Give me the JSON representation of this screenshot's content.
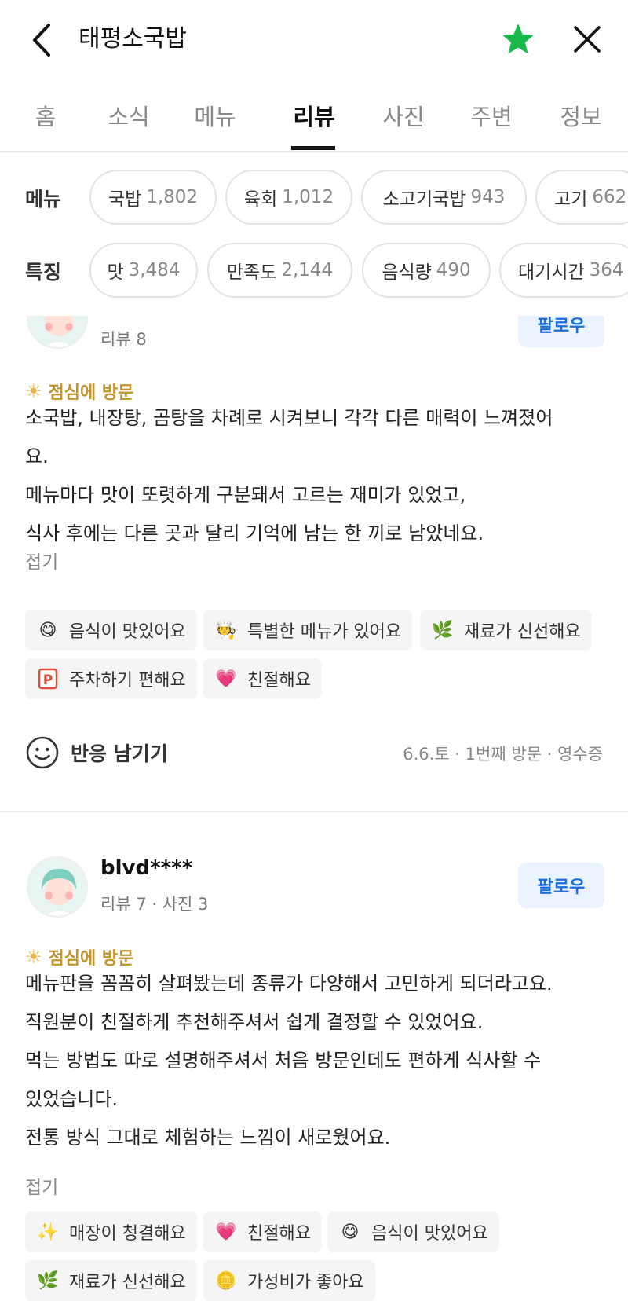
{
  "header": {
    "title": "태평소국밥",
    "back_icon": "chevron-left-icon",
    "star_icon": "star-icon",
    "close_icon": "close-icon",
    "star_color": "#18b849"
  },
  "tabs": [
    {
      "label": "홈"
    },
    {
      "label": "소식"
    },
    {
      "label": "메뉴"
    },
    {
      "label": "리뷰",
      "active": true
    },
    {
      "label": "사진"
    },
    {
      "label": "주변"
    },
    {
      "label": "정보"
    }
  ],
  "filters": {
    "menu": {
      "label": "메뉴",
      "chips": [
        {
          "name": "국밥",
          "count": "1,802"
        },
        {
          "name": "육회",
          "count": "1,012"
        },
        {
          "name": "소고기국밥",
          "count": "943"
        },
        {
          "name": "고기",
          "count": "662"
        }
      ]
    },
    "feature": {
      "label": "특징",
      "chips": [
        {
          "name": "맛",
          "count": "3,484"
        },
        {
          "name": "만족도",
          "count": "2,144"
        },
        {
          "name": "음식량",
          "count": "490"
        },
        {
          "name": "대기시간",
          "count": "364"
        }
      ]
    }
  },
  "review1": {
    "follow": "팔로우",
    "meta": "리뷰 8",
    "visit": "점심에 방문",
    "lines": [
      "소국밥, 내장탕, 곰탕을 차례로 시켜보니 각각 다른 매력이 느껴졌어",
      "요.",
      "메뉴마다 맛이 또렷하게 구분돼서 고르는 재미가 있었고,",
      "식사 후에는 다른 곳과 달리 기억에 남는 한 끼로 남았네요."
    ],
    "fold": "접기",
    "tags": [
      {
        "icon": "smile-emoji-icon",
        "label": "음식이 맛있어요"
      },
      {
        "icon": "chef-icon",
        "label": "특별한 메뉴가 있어요"
      },
      {
        "icon": "leaf-icon",
        "label": "재료가 신선해요"
      },
      {
        "icon": "parking-icon",
        "label": "주차하기 편해요"
      },
      {
        "icon": "heart-icon",
        "label": "친절해요"
      }
    ],
    "react_label": "반응 남기기",
    "visit_info": "6.6.토 · 1번째 방문 · 영수증"
  },
  "review2": {
    "nickname": "blvd****",
    "follow": "팔로우",
    "meta": "리뷰 7 · 사진 3",
    "visit": "점심에 방문",
    "lines": [
      "메뉴판을 꼼꼼히 살펴봤는데 종류가 다양해서 고민하게 되더라고요.",
      "직원분이 친절하게 추천해주셔서 쉽게 결정할 수 있었어요.",
      "먹는 방법도 따로 설명해주셔서 처음 방문인데도 편하게 식사할 수",
      "있었습니다.",
      "전통 방식 그대로 체험하는 느낌이 새로웠어요."
    ],
    "fold": "접기",
    "tags": [
      {
        "icon": "sparkle-icon",
        "label": "매장이 청결해요"
      },
      {
        "icon": "heart-icon",
        "label": "친절해요"
      },
      {
        "icon": "smile-emoji-icon",
        "label": "음식이 맛있어요"
      },
      {
        "icon": "leaf-icon",
        "label": "재료가 신선해요"
      },
      {
        "icon": "coin-icon",
        "label": "가성비가 좋아요"
      }
    ]
  }
}
